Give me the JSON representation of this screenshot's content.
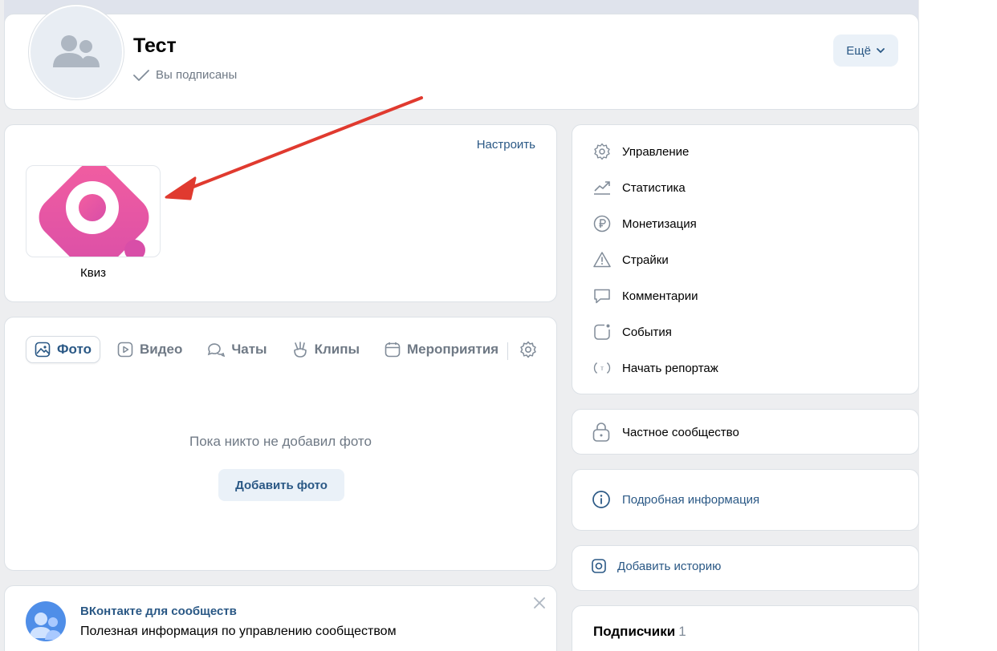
{
  "header": {
    "title": "Тест",
    "subscribed_label": "Вы подписаны",
    "more_label": "Ещё"
  },
  "apps": {
    "configure_label": "Настроить",
    "items": [
      {
        "label": "Квиз",
        "icon": "quiz-app-icon",
        "colors": [
          "#f0569f",
          "#d94fa6"
        ]
      }
    ]
  },
  "media": {
    "tabs": [
      {
        "label": "Фото",
        "icon": "photo-icon",
        "active": true
      },
      {
        "label": "Видео",
        "icon": "video-icon",
        "active": false
      },
      {
        "label": "Чаты",
        "icon": "chats-icon",
        "active": false
      },
      {
        "label": "Клипы",
        "icon": "clips-icon",
        "active": false
      },
      {
        "label": "Мероприятия",
        "icon": "calendar-icon",
        "active": false
      }
    ],
    "empty_text": "Пока никто не добавил фото",
    "add_button_label": "Добавить фото"
  },
  "promo": {
    "title": "ВКонтакте для сообществ",
    "text": "Полезная информация по управлению сообществом"
  },
  "menu": {
    "items": [
      {
        "label": "Управление",
        "icon": "gear-icon"
      },
      {
        "label": "Статистика",
        "icon": "stats-icon"
      },
      {
        "label": "Монетизация",
        "icon": "ruble-icon"
      },
      {
        "label": "Страйки",
        "icon": "warning-icon"
      },
      {
        "label": "Комментарии",
        "icon": "comment-icon"
      },
      {
        "label": "События",
        "icon": "events-icon"
      },
      {
        "label": "Начать репортаж",
        "icon": "broadcast-icon"
      }
    ]
  },
  "private": {
    "label": "Частное сообщество"
  },
  "info": {
    "label": "Подробная информация"
  },
  "story": {
    "label": "Добавить историю"
  },
  "subscribers": {
    "title": "Подписчики",
    "count": "1"
  },
  "colors": {
    "link": "#2a5885",
    "accent": "#e64646",
    "background": "#edeef0"
  }
}
